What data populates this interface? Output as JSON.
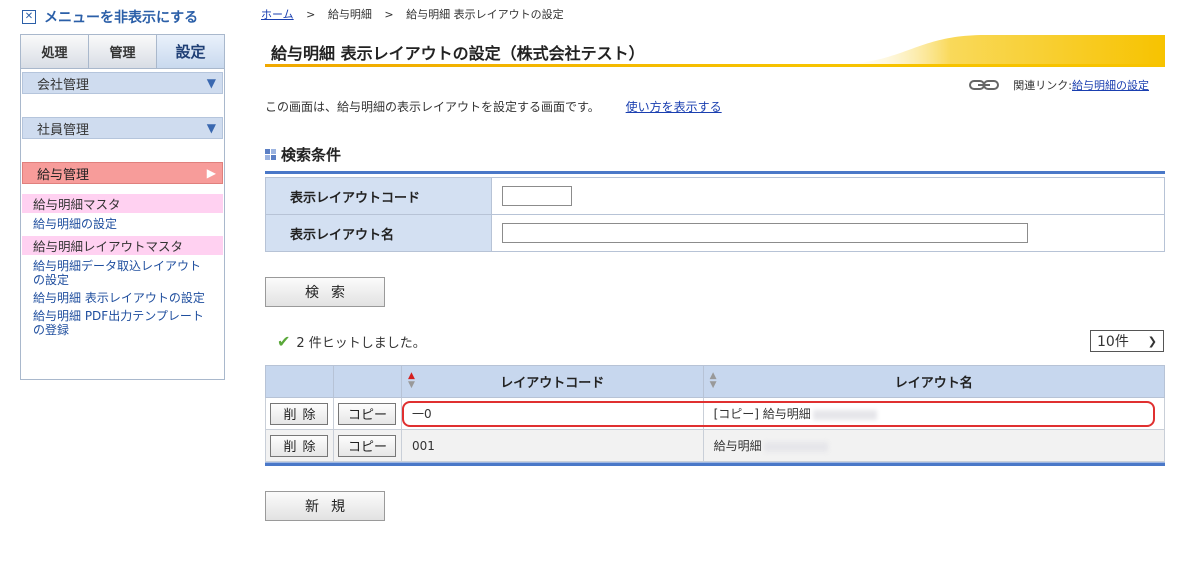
{
  "sidebar": {
    "hide_menu_label": "メニューを非表示にする",
    "tabs": [
      {
        "label": "処理",
        "active": false
      },
      {
        "label": "管理",
        "active": false
      },
      {
        "label": "設定",
        "active": true
      }
    ],
    "categories": {
      "company": "会社管理",
      "employee": "社員管理",
      "payroll": "給与管理"
    },
    "payroll_menu": {
      "group1_title": "給与明細マスタ",
      "group1_links": [
        "給与明細の設定"
      ],
      "group2_title": "給与明細レイアウトマスタ",
      "group2_links": [
        "給与明細データ取込レイアウトの設定",
        "給与明細 表示レイアウトの設定",
        "給与明細 PDF出力テンプレートの登録"
      ]
    }
  },
  "breadcrumb": {
    "home": "ホーム",
    "level1": "給与明細",
    "current": "給与明細 表示レイアウトの設定",
    "separator": ">"
  },
  "page": {
    "title": "給与明細 表示レイアウトの設定（株式会社テスト）",
    "related_label": "関連リンク:",
    "related_link": "給与明細の設定",
    "description": "この画面は、給与明細の表示レイアウトを設定する画面です。",
    "howto_link": "使い方を表示する",
    "accent_color": "#f7c300",
    "primary_color": "#4a78c8"
  },
  "search": {
    "section_title": "検索条件",
    "code_label": "表示レイアウトコード",
    "code_value": "",
    "name_label": "表示レイアウト名",
    "name_value": "",
    "search_button": "検索"
  },
  "results": {
    "hit_text": "2 件ヒットしました。",
    "per_page": "10件",
    "columns": {
      "code": "レイアウトコード",
      "name": "レイアウト名"
    },
    "sort_column": "code",
    "delete_label": "削除",
    "copy_label": "コピー",
    "rows": [
      {
        "code": "一0",
        "name": "[コピー] 給与明細"
      },
      {
        "code": "001",
        "name": "給与明細"
      }
    ]
  },
  "new_button": "新規",
  "icons": {
    "hide_menu": "close-box-icon",
    "dropdown": "triangle-down-icon",
    "expand": "triangle-right-icon",
    "chain": "link-chain-icon",
    "check": "check-icon",
    "section": "grid-square-icon",
    "sort": "sort-arrows-icon"
  }
}
